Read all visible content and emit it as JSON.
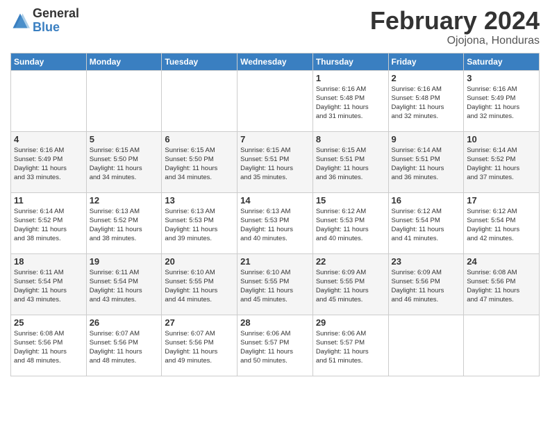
{
  "logo": {
    "general": "General",
    "blue": "Blue"
  },
  "header": {
    "month": "February 2024",
    "location": "Ojojona, Honduras"
  },
  "weekdays": [
    "Sunday",
    "Monday",
    "Tuesday",
    "Wednesday",
    "Thursday",
    "Friday",
    "Saturday"
  ],
  "weeks": [
    [
      {
        "day": "",
        "info": ""
      },
      {
        "day": "",
        "info": ""
      },
      {
        "day": "",
        "info": ""
      },
      {
        "day": "",
        "info": ""
      },
      {
        "day": "1",
        "info": "Sunrise: 6:16 AM\nSunset: 5:48 PM\nDaylight: 11 hours\nand 31 minutes."
      },
      {
        "day": "2",
        "info": "Sunrise: 6:16 AM\nSunset: 5:48 PM\nDaylight: 11 hours\nand 32 minutes."
      },
      {
        "day": "3",
        "info": "Sunrise: 6:16 AM\nSunset: 5:49 PM\nDaylight: 11 hours\nand 32 minutes."
      }
    ],
    [
      {
        "day": "4",
        "info": "Sunrise: 6:16 AM\nSunset: 5:49 PM\nDaylight: 11 hours\nand 33 minutes."
      },
      {
        "day": "5",
        "info": "Sunrise: 6:15 AM\nSunset: 5:50 PM\nDaylight: 11 hours\nand 34 minutes."
      },
      {
        "day": "6",
        "info": "Sunrise: 6:15 AM\nSunset: 5:50 PM\nDaylight: 11 hours\nand 34 minutes."
      },
      {
        "day": "7",
        "info": "Sunrise: 6:15 AM\nSunset: 5:51 PM\nDaylight: 11 hours\nand 35 minutes."
      },
      {
        "day": "8",
        "info": "Sunrise: 6:15 AM\nSunset: 5:51 PM\nDaylight: 11 hours\nand 36 minutes."
      },
      {
        "day": "9",
        "info": "Sunrise: 6:14 AM\nSunset: 5:51 PM\nDaylight: 11 hours\nand 36 minutes."
      },
      {
        "day": "10",
        "info": "Sunrise: 6:14 AM\nSunset: 5:52 PM\nDaylight: 11 hours\nand 37 minutes."
      }
    ],
    [
      {
        "day": "11",
        "info": "Sunrise: 6:14 AM\nSunset: 5:52 PM\nDaylight: 11 hours\nand 38 minutes."
      },
      {
        "day": "12",
        "info": "Sunrise: 6:13 AM\nSunset: 5:52 PM\nDaylight: 11 hours\nand 38 minutes."
      },
      {
        "day": "13",
        "info": "Sunrise: 6:13 AM\nSunset: 5:53 PM\nDaylight: 11 hours\nand 39 minutes."
      },
      {
        "day": "14",
        "info": "Sunrise: 6:13 AM\nSunset: 5:53 PM\nDaylight: 11 hours\nand 40 minutes."
      },
      {
        "day": "15",
        "info": "Sunrise: 6:12 AM\nSunset: 5:53 PM\nDaylight: 11 hours\nand 40 minutes."
      },
      {
        "day": "16",
        "info": "Sunrise: 6:12 AM\nSunset: 5:54 PM\nDaylight: 11 hours\nand 41 minutes."
      },
      {
        "day": "17",
        "info": "Sunrise: 6:12 AM\nSunset: 5:54 PM\nDaylight: 11 hours\nand 42 minutes."
      }
    ],
    [
      {
        "day": "18",
        "info": "Sunrise: 6:11 AM\nSunset: 5:54 PM\nDaylight: 11 hours\nand 43 minutes."
      },
      {
        "day": "19",
        "info": "Sunrise: 6:11 AM\nSunset: 5:54 PM\nDaylight: 11 hours\nand 43 minutes."
      },
      {
        "day": "20",
        "info": "Sunrise: 6:10 AM\nSunset: 5:55 PM\nDaylight: 11 hours\nand 44 minutes."
      },
      {
        "day": "21",
        "info": "Sunrise: 6:10 AM\nSunset: 5:55 PM\nDaylight: 11 hours\nand 45 minutes."
      },
      {
        "day": "22",
        "info": "Sunrise: 6:09 AM\nSunset: 5:55 PM\nDaylight: 11 hours\nand 45 minutes."
      },
      {
        "day": "23",
        "info": "Sunrise: 6:09 AM\nSunset: 5:56 PM\nDaylight: 11 hours\nand 46 minutes."
      },
      {
        "day": "24",
        "info": "Sunrise: 6:08 AM\nSunset: 5:56 PM\nDaylight: 11 hours\nand 47 minutes."
      }
    ],
    [
      {
        "day": "25",
        "info": "Sunrise: 6:08 AM\nSunset: 5:56 PM\nDaylight: 11 hours\nand 48 minutes."
      },
      {
        "day": "26",
        "info": "Sunrise: 6:07 AM\nSunset: 5:56 PM\nDaylight: 11 hours\nand 48 minutes."
      },
      {
        "day": "27",
        "info": "Sunrise: 6:07 AM\nSunset: 5:56 PM\nDaylight: 11 hours\nand 49 minutes."
      },
      {
        "day": "28",
        "info": "Sunrise: 6:06 AM\nSunset: 5:57 PM\nDaylight: 11 hours\nand 50 minutes."
      },
      {
        "day": "29",
        "info": "Sunrise: 6:06 AM\nSunset: 5:57 PM\nDaylight: 11 hours\nand 51 minutes."
      },
      {
        "day": "",
        "info": ""
      },
      {
        "day": "",
        "info": ""
      }
    ]
  ]
}
